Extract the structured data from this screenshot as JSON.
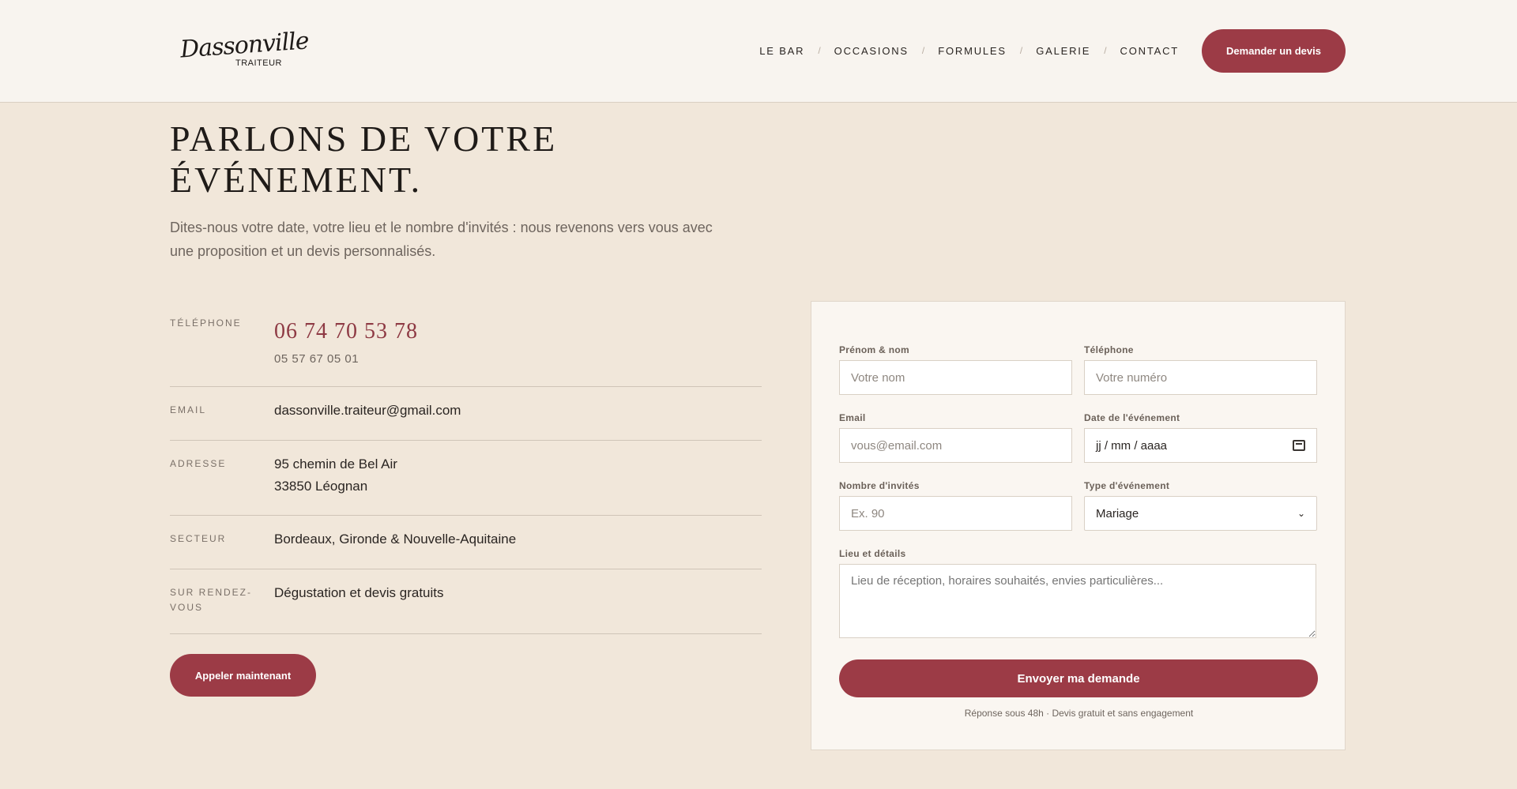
{
  "header": {
    "logo_script": "Dassonville",
    "logo_sub": "TRAITEUR",
    "nav": [
      {
        "label": "LE BAR"
      },
      {
        "label": "OCCASIONS"
      },
      {
        "label": "FORMULES"
      },
      {
        "label": "GALERIE"
      },
      {
        "label": "CONTACT"
      }
    ],
    "nav_separator": "/",
    "cta_label": "Demander un devis"
  },
  "hero": {
    "title": "PARLONS DE VOTRE ÉVÉNEMENT.",
    "subtitle": "Dites-nous votre date, votre lieu et le nombre d'invités : nous revenons vers vous avec une proposition et un devis personnalisés."
  },
  "contact": {
    "phone_label": "TÉLÉPHONE",
    "phone_main": "06 74 70 53 78",
    "phone_alt": "05 57 67 05 01",
    "email_label": "EMAIL",
    "email": "dassonville.traiteur@gmail.com",
    "address_label": "ADRESSE",
    "address_line1": "95 chemin de Bel Air",
    "address_line2": "33850 Léognan",
    "sector_label": "SECTEUR",
    "sector": "Bordeaux, Gironde & Nouvelle-Aquitaine",
    "appointment_label": "SUR RENDEZ-VOUS",
    "appointment": "Dégustation et devis gratuits",
    "call_button": "Appeler maintenant"
  },
  "form": {
    "name_label": "Prénom & nom",
    "name_placeholder": "Votre nom",
    "phone_label": "Téléphone",
    "phone_placeholder": "Votre numéro",
    "email_label": "Email",
    "email_placeholder": "vous@email.com",
    "date_label": "Date de l'événement",
    "date_placeholder": "jj / mm / aaaa",
    "guests_label": "Nombre d'invités",
    "guests_placeholder": "Ex. 90",
    "type_label": "Type d'événement",
    "type_value": "Mariage",
    "details_label": "Lieu et détails",
    "details_placeholder": "Lieu de réception, horaires souhaités, envies particulières...",
    "submit_label": "Envoyer ma demande",
    "note": "Réponse sous 48h · Devis gratuit et sans engagement"
  },
  "colors": {
    "accent": "#9c3b46",
    "background": "#f1e7da",
    "header_bg": "#f8f4ef",
    "card_bg": "#faf6f1"
  }
}
